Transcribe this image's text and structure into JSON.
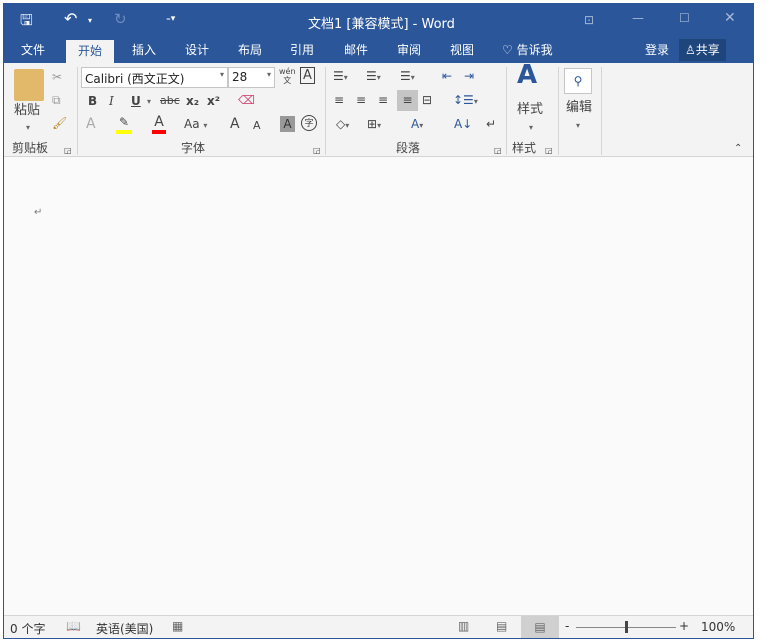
{
  "title": "文档1 [兼容模式] - Word",
  "tabs": [
    "文件",
    "开始",
    "插入",
    "设计",
    "布局",
    "引用",
    "邮件",
    "审阅",
    "视图"
  ],
  "tell_me": "告诉我",
  "signin": "登录",
  "share": "共享",
  "clipboard": {
    "paste": "粘贴",
    "group": "剪贴板"
  },
  "font": {
    "name": "Calibri (西文正文)",
    "size": "28",
    "group": "字体",
    "phonetic_top": "wén",
    "phonetic_bottom": "文",
    "bold": "B",
    "italic": "I",
    "underline": "U",
    "strike": "abc",
    "sub": "x₂",
    "sup": "x²",
    "case": "Aa",
    "grow": "A",
    "shrink": "A",
    "shade": "A",
    "enclose": "字"
  },
  "paragraph": {
    "group": "段落"
  },
  "styles": {
    "label": "样式",
    "group": "样式"
  },
  "editing": {
    "label": "编辑"
  },
  "status": {
    "words": "0 个字",
    "language": "英语(美国)",
    "zoom": "100%"
  },
  "zoom_fraction": 0.5,
  "colors": {
    "accent": "#2b579a",
    "highlight": "#ffff00",
    "font_color": "#ff0000"
  }
}
